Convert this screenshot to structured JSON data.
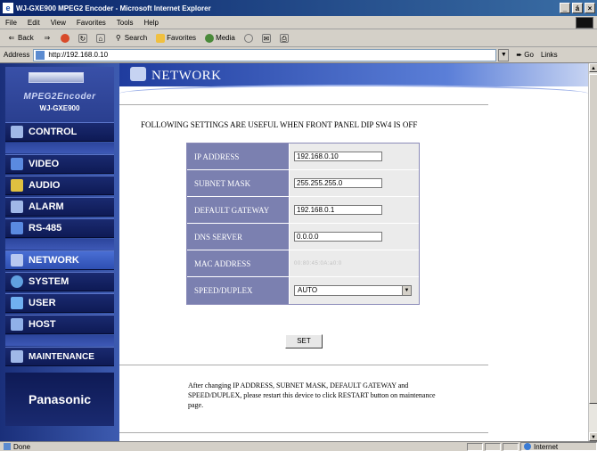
{
  "window": {
    "title": "WJ-GXE900 MPEG2 Encoder - Microsoft Internet Explorer",
    "min": "_",
    "max": "á",
    "close": "×"
  },
  "menu": [
    "File",
    "Edit",
    "View",
    "Favorites",
    "Tools",
    "Help"
  ],
  "toolbar": {
    "back": "Back",
    "search": "Search",
    "favorites": "Favorites",
    "media": "Media"
  },
  "address": {
    "label": "Address",
    "url": "http://192.168.0.10",
    "go": "Go",
    "links": "Links"
  },
  "status": {
    "text": "Done",
    "zone": "Internet"
  },
  "nav": {
    "logo_line1": "MPEG2Encoder",
    "logo_line2": "WJ-GXE900",
    "items": [
      {
        "label": "CONTROL"
      },
      {
        "label": "VIDEO"
      },
      {
        "label": "AUDIO"
      },
      {
        "label": "ALARM"
      },
      {
        "label": "RS-485"
      },
      {
        "label": "NETWORK"
      },
      {
        "label": "SYSTEM"
      },
      {
        "label": "USER"
      },
      {
        "label": "HOST"
      },
      {
        "label": "MAINTENANCE"
      }
    ],
    "brand": "Panasonic"
  },
  "page": {
    "title": "NETWORK",
    "notice": "FOLLOWING SETTINGS ARE USEFUL WHEN FRONT PANEL DIP SW4 IS OFF",
    "fields": {
      "ip_label": "IP ADDRESS",
      "ip_value": "192.168.0.10",
      "subnet_label": "SUBNET MASK",
      "subnet_value": "255.255.255.0",
      "gateway_label": "DEFAULT GATEWAY",
      "gateway_value": "192.168.0.1",
      "dns_label": "DNS SERVER",
      "dns_value": "0.0.0.0",
      "mac_label": "MAC ADDRESS",
      "mac_value": "00:80:45:0A:a0:0",
      "speed_label": "SPEED/DUPLEX",
      "speed_value": "AUTO"
    },
    "set_button": "SET",
    "footnote": "After changing IP ADDRESS, SUBNET MASK, DEFAULT GATEWAY and SPEED/DUPLEX, please restart this device to click RESTART button on maintenance page."
  }
}
